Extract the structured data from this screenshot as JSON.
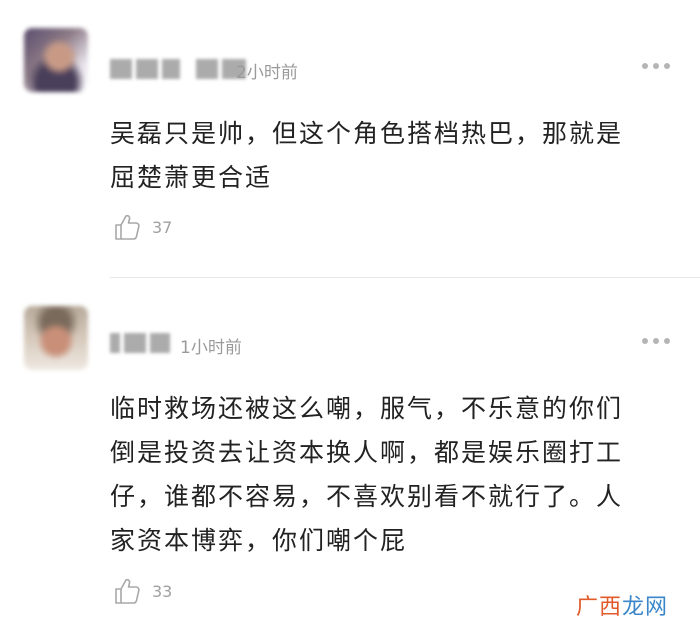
{
  "comments": [
    {
      "time": "2小时前",
      "text_lines": [
        "吴磊只是帅，但这个角色搭档热巴，那就是",
        "屈楚萧更合适"
      ],
      "likes": "37"
    },
    {
      "time": "1小时前",
      "text_lines": [
        "临时救场还被这么嘲，服气，不乐意的你们",
        "倒是投资去让资本换人啊，都是娱乐圈打工",
        "仔，谁都不容易，不喜欢别看不就行了。人",
        "家资本博弈，你们嘲个屁"
      ],
      "likes": "33"
    }
  ],
  "watermark": {
    "part1": "广西",
    "part2": "龙网"
  },
  "colors": {
    "watermark_orange": "#e05a2a",
    "watermark_blue": "#3a86c8",
    "muted": "#9a9a9a"
  },
  "icons": {
    "like": "thumbs-up-icon",
    "more": "more-dots-icon"
  }
}
